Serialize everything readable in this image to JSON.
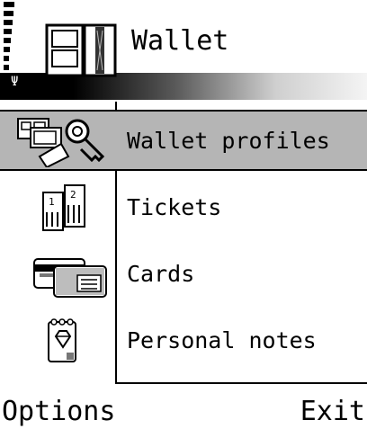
{
  "header": {
    "title": "Wallet",
    "app_icon": "wallet-icon",
    "signal_icon": "antenna-icon"
  },
  "list": {
    "selected_index": 0,
    "items": [
      {
        "label": "Wallet profiles",
        "icon": "profile-cards-key-icon"
      },
      {
        "label": "Tickets",
        "icon": "tickets-icon"
      },
      {
        "label": "Cards",
        "icon": "cards-icon"
      },
      {
        "label": "Personal notes",
        "icon": "notepad-gem-icon"
      }
    ]
  },
  "softkeys": {
    "left": "Options",
    "right": "Exit"
  },
  "colors": {
    "selection": "#b5b5b5",
    "foreground": "#000000",
    "background": "#ffffff"
  }
}
